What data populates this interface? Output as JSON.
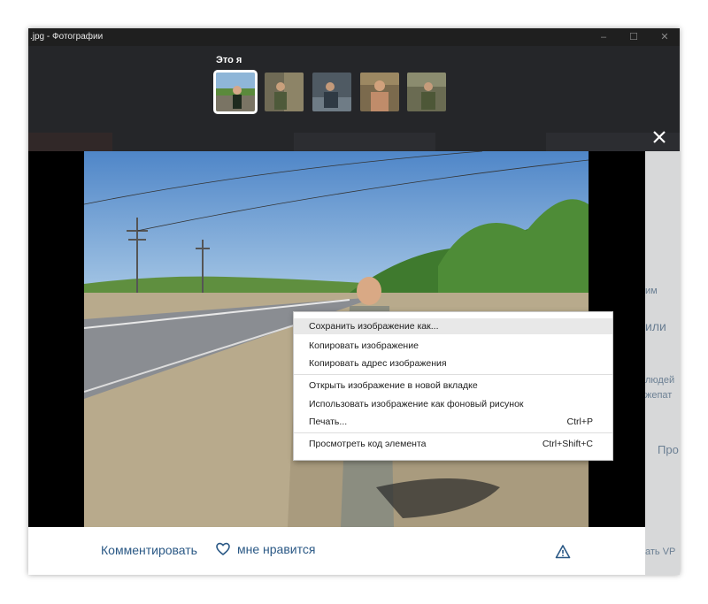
{
  "window": {
    "title": ".jpg - Фотографии",
    "minimize_glyph": "–",
    "maximize_glyph": "☐",
    "close_glyph": "✕"
  },
  "tags": {
    "title": "Это я",
    "thumbnails": [
      {
        "name": "thumb-1",
        "selected": true
      },
      {
        "name": "thumb-2",
        "selected": false
      },
      {
        "name": "thumb-3",
        "selected": false
      },
      {
        "name": "thumb-4",
        "selected": false
      },
      {
        "name": "thumb-5",
        "selected": false
      }
    ]
  },
  "viewer": {
    "close_icon": "close-icon"
  },
  "bottom_bar": {
    "comment_label": "Комментировать",
    "like_label": "мне нравится",
    "like_icon": "heart-icon",
    "report_icon": "warning-icon",
    "link_color": "#2a5885"
  },
  "side_peek": {
    "lines": [
      "им",
      "или",
      "людей",
      "жепат",
      "Про",
      "ать VP"
    ]
  },
  "context_menu": {
    "items": [
      {
        "label": "Сохранить изображение как...",
        "shortcut": ""
      },
      {
        "label": "Копировать изображение",
        "shortcut": ""
      },
      {
        "label": "Копировать адрес изображения",
        "shortcut": ""
      },
      {
        "label": "Открыть изображение в новой вкладке",
        "shortcut": ""
      },
      {
        "label": "Использовать изображение как фоновый рисунок",
        "shortcut": ""
      },
      {
        "label": "Печать...",
        "shortcut": "Ctrl+P"
      },
      {
        "label": "Просмотреть код элемента",
        "shortcut": "Ctrl+Shift+C"
      }
    ]
  }
}
